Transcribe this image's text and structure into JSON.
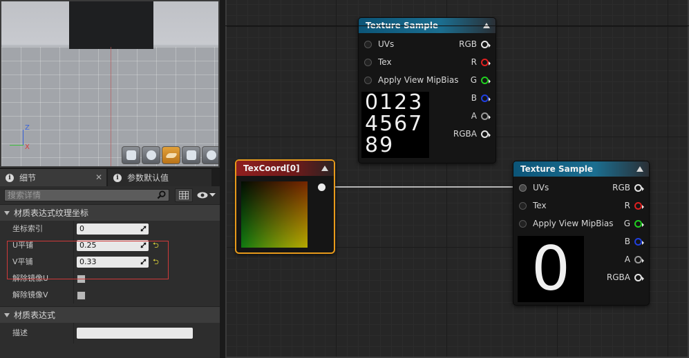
{
  "viewport": {
    "axis_labels": {
      "z": "Z",
      "x": "X"
    },
    "preview_buttons": [
      {
        "icon": "cylinder-icon",
        "active": false
      },
      {
        "icon": "sphere-icon",
        "active": false
      },
      {
        "icon": "plane-icon",
        "active": true
      },
      {
        "icon": "cube-icon",
        "active": false
      },
      {
        "icon": "teapot-icon",
        "active": false
      }
    ]
  },
  "details": {
    "tabs": [
      {
        "label": "细节",
        "close": "✕"
      },
      {
        "label": "参数默认值",
        "close": ""
      }
    ],
    "search_placeholder": "搜索详情",
    "sections": {
      "tex_coord": "材质表达式纹理坐标",
      "material_expression": "材质表达式"
    },
    "properties": {
      "coord_index": {
        "label": "坐标索引",
        "value": "0"
      },
      "u_tiling": {
        "label": "U平铺",
        "value": "0.25"
      },
      "v_tiling": {
        "label": "V平铺",
        "value": "0.33"
      },
      "unmirror_u": {
        "label": "解除镜像U"
      },
      "unmirror_v": {
        "label": "解除镜像V"
      },
      "description": {
        "label": "描述",
        "value": ""
      }
    },
    "reset_glyph": "⮌"
  },
  "graph": {
    "node_tex1": {
      "title": "Texture Sample",
      "inputs": [
        "UVs",
        "Tex",
        "Apply View MipBias"
      ],
      "outputs": [
        "RGB",
        "R",
        "G",
        "B",
        "A",
        "RGBA"
      ],
      "preview_lines": [
        "0123",
        "4567",
        "89"
      ]
    },
    "node_texcoord": {
      "title": "TexCoord[0]"
    },
    "node_tex2": {
      "title": "Texture Sample",
      "inputs": [
        "UVs",
        "Tex",
        "Apply View MipBias"
      ],
      "outputs": [
        "RGB",
        "R",
        "G",
        "B",
        "A",
        "RGBA"
      ],
      "preview": "0"
    },
    "colors": {
      "r": "#e02020",
      "g": "#20d020",
      "b": "#2040e0",
      "white": "#e6e6e6"
    }
  }
}
